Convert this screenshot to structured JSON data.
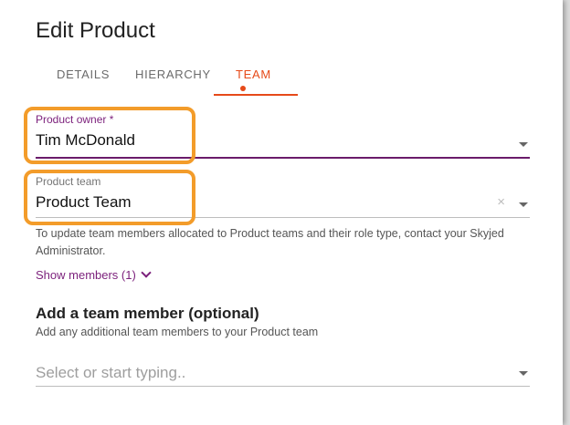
{
  "page": {
    "title": "Edit Product"
  },
  "tabs": [
    {
      "label": "DETAILS"
    },
    {
      "label": "HIERARCHY"
    },
    {
      "label": "TEAM",
      "active": true,
      "has_dot": true
    }
  ],
  "product_owner": {
    "label": "Product owner *",
    "value": "Tim McDonald"
  },
  "product_team": {
    "label": "Product team",
    "value": "Product Team",
    "clear_glyph": "×"
  },
  "helper_text": "To update team members allocated to Product teams and their role type, contact your Skyjed Administrator.",
  "show_members": {
    "label": "Show members (1)"
  },
  "add_member": {
    "title": "Add a team member (optional)",
    "subtitle": "Add any additional team members to your Product team",
    "placeholder": "Select or start typing.."
  },
  "colors": {
    "accent": "#e64a19",
    "purple": "#7b1f7b",
    "highlight": "#f39c2a"
  }
}
